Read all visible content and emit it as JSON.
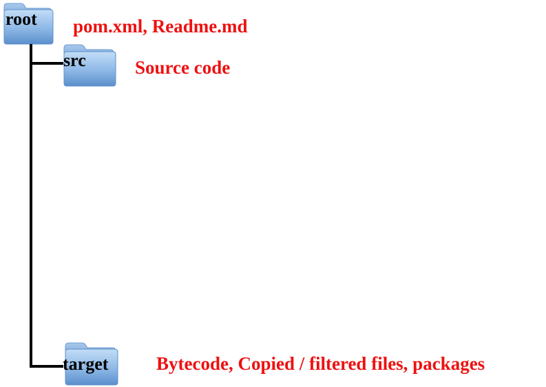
{
  "colors": {
    "annotation": "#ee1111",
    "connector": "#000000",
    "folder_light": "#b9d7f3",
    "folder_dark": "#5f93cf"
  },
  "nodes": [
    {
      "id": "root",
      "label": "root",
      "icon": "folder-icon",
      "annotation": "pom.xml, Readme.md"
    },
    {
      "id": "src",
      "label": "src",
      "icon": "folder-icon",
      "annotation": "Source code"
    },
    {
      "id": "target",
      "label": "target",
      "icon": "folder-icon",
      "annotation": "Bytecode, Copied / filtered files, packages"
    }
  ]
}
